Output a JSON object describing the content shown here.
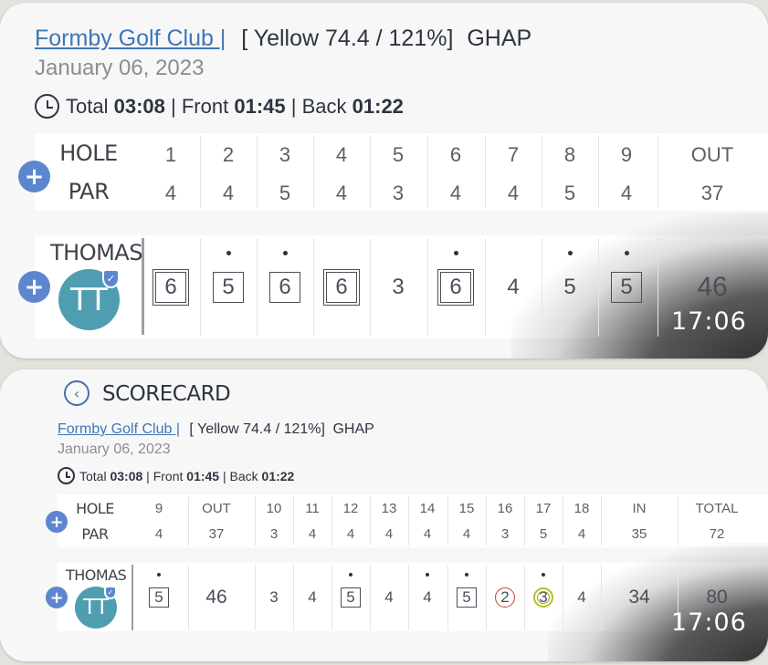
{
  "header": {
    "course": "Formby Golf Club |",
    "tee_info": "[ Yellow 74.4 / 121%]",
    "ghap": "GHAP",
    "date": "January 06, 2023"
  },
  "times": {
    "total_label": "Total",
    "total": "03:08",
    "front_label": "Front",
    "front": "01:45",
    "back_label": "Back",
    "back": "01:22",
    "sep": "|"
  },
  "labels": {
    "hole": "HOLE",
    "par": "PAR",
    "plus": "+",
    "player": "THOMAS",
    "initials": "TT"
  },
  "front": {
    "holes": [
      "1",
      "2",
      "3",
      "4",
      "5",
      "6",
      "7",
      "8",
      "9",
      "OUT"
    ],
    "pars": [
      "4",
      "4",
      "5",
      "4",
      "3",
      "4",
      "4",
      "5",
      "4",
      "37"
    ],
    "scores": [
      "6",
      "5",
      "6",
      "6",
      "3",
      "6",
      "4",
      "5",
      "5",
      "46"
    ],
    "marks": [
      "double-square",
      "square",
      "square",
      "double-square",
      "none",
      "double-square",
      "none",
      "none",
      "square",
      "none"
    ],
    "dots": [
      0,
      1,
      1,
      0,
      0,
      1,
      0,
      1,
      1,
      0
    ]
  },
  "back": {
    "holes": [
      "9",
      "OUT",
      "10",
      "11",
      "12",
      "13",
      "14",
      "15",
      "16",
      "17",
      "18",
      "IN",
      "TOTAL"
    ],
    "pars": [
      "4",
      "37",
      "3",
      "4",
      "4",
      "4",
      "4",
      "4",
      "3",
      "5",
      "4",
      "35",
      "72"
    ],
    "scores": [
      "5",
      "46",
      "3",
      "4",
      "5",
      "4",
      "4",
      "5",
      "2",
      "3",
      "4",
      "34",
      "80"
    ],
    "marks": [
      "square",
      "none",
      "none",
      "none",
      "square",
      "none",
      "none",
      "square",
      "circle-red",
      "circle-yellow",
      "none",
      "none",
      "none"
    ],
    "dots": [
      1,
      0,
      0,
      0,
      1,
      0,
      1,
      1,
      0,
      1,
      0,
      0,
      0
    ]
  },
  "screen2": {
    "title": "SCORECARD"
  },
  "timestamp": "17:06",
  "colors": {
    "link": "#3f76b5",
    "accent": "#5d86cf",
    "avatar": "#4f9db1",
    "birdie_red": "#c9403a",
    "eagle_yellow": "#b9bd2a"
  }
}
